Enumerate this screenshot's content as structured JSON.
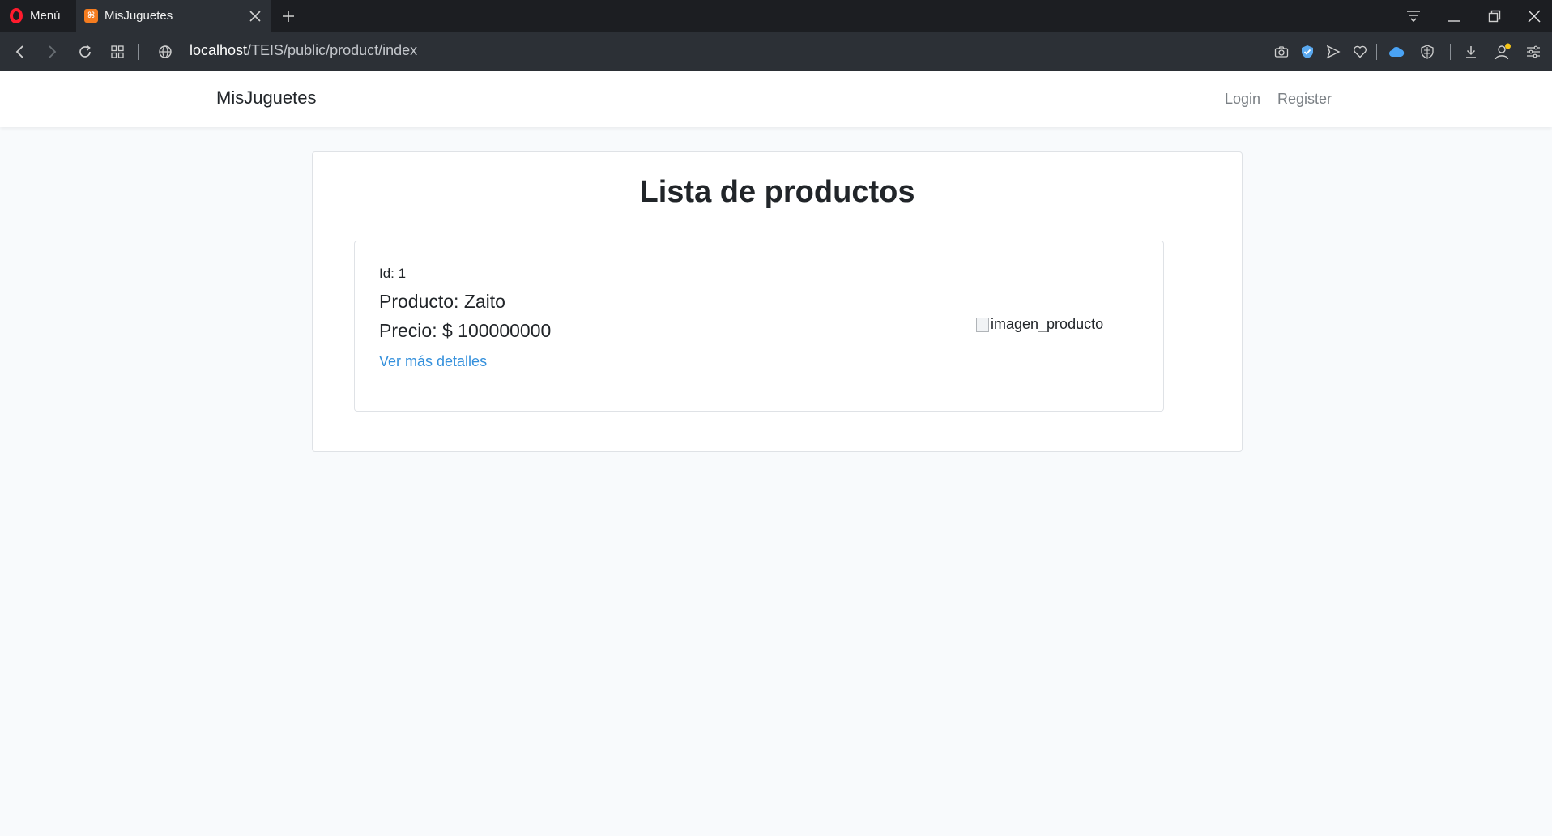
{
  "browser": {
    "menu_label": "Menú",
    "tab_title": "MisJuguetes",
    "url_host": "localhost",
    "url_path": "/TEIS/public/product/index"
  },
  "navbar": {
    "brand": "MisJuguetes",
    "login": "Login",
    "register": "Register"
  },
  "page": {
    "title": "Lista de productos"
  },
  "products": [
    {
      "id_text": "Id: 1",
      "name_text": "Producto: Zaito",
      "price_text": "Precio: $ 100000000",
      "details_link": "Ver más detalles",
      "image_alt": "imagen_producto"
    }
  ],
  "colors": {
    "link": "#3490dc",
    "opera_red": "#ff1b2d",
    "page_bg": "#f8fafc"
  },
  "icons": [
    "opera-logo-icon",
    "close-icon",
    "plus-icon",
    "tab-search-icon",
    "minimize-icon",
    "restore-icon",
    "window-close-icon",
    "back-icon",
    "forward-icon",
    "reload-icon",
    "tabs-grid-icon",
    "globe-icon",
    "camera-icon",
    "shield-icon",
    "send-icon",
    "heart-icon",
    "cloud-icon",
    "vpn-icon",
    "download-icon",
    "profile-icon",
    "easy-setup-icon"
  ]
}
